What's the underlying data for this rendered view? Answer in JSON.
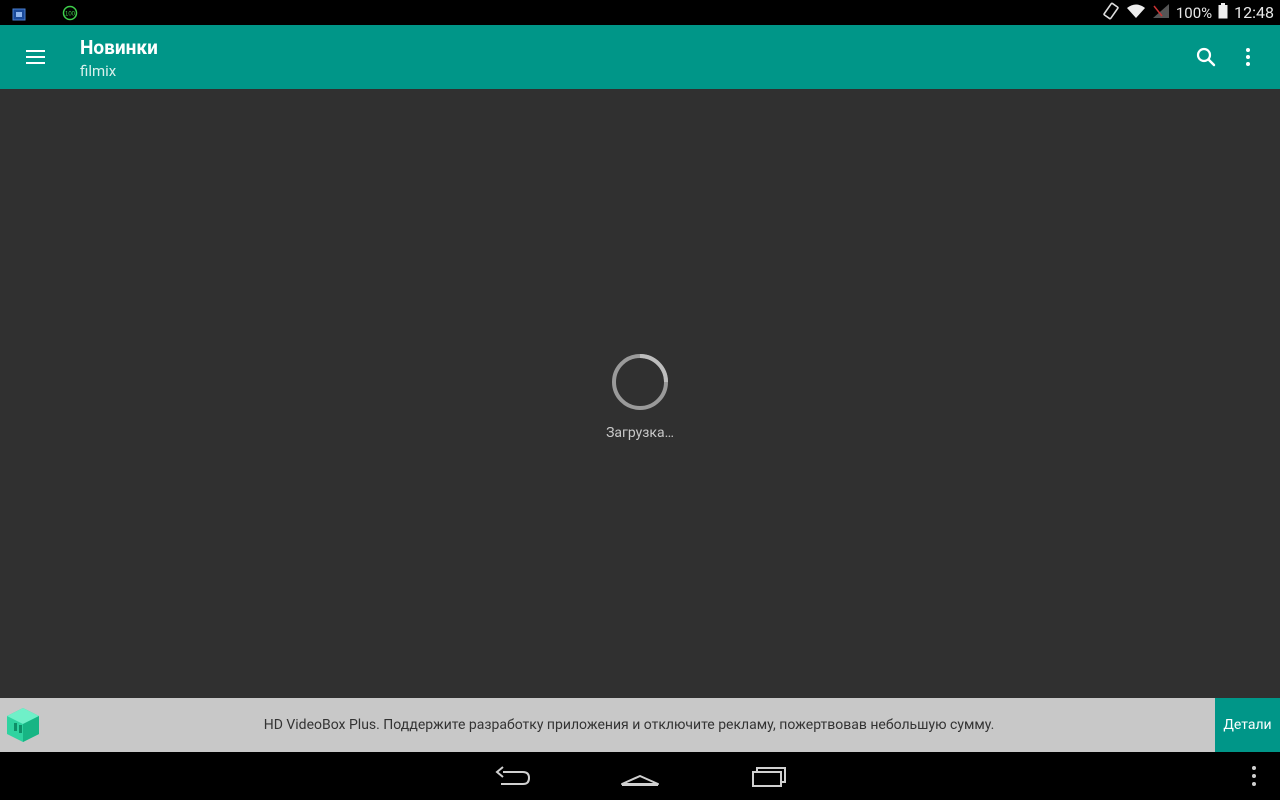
{
  "status_bar": {
    "battery_percent": "100%",
    "time": "12:48",
    "left_icons": [
      "calendar-notification-icon",
      "speed-indicator-icon"
    ],
    "left_badge_100": "100",
    "right_icons": [
      "rotation-lock-icon",
      "wifi-icon",
      "no-signal-icon",
      "battery-icon"
    ]
  },
  "toolbar": {
    "title": "Новинки",
    "subtitle": "filmix",
    "color": "#009688"
  },
  "content": {
    "loading_text": "Загрузка…"
  },
  "banner": {
    "message": "HD VideoBox Plus. Поддержите разработку приложения и отключите рекламу, пожертвовав небольшую сумму.",
    "button_label": "Детали"
  },
  "nav_bar": {
    "buttons": [
      "back-icon",
      "home-icon",
      "recents-icon",
      "overflow-icon"
    ]
  }
}
